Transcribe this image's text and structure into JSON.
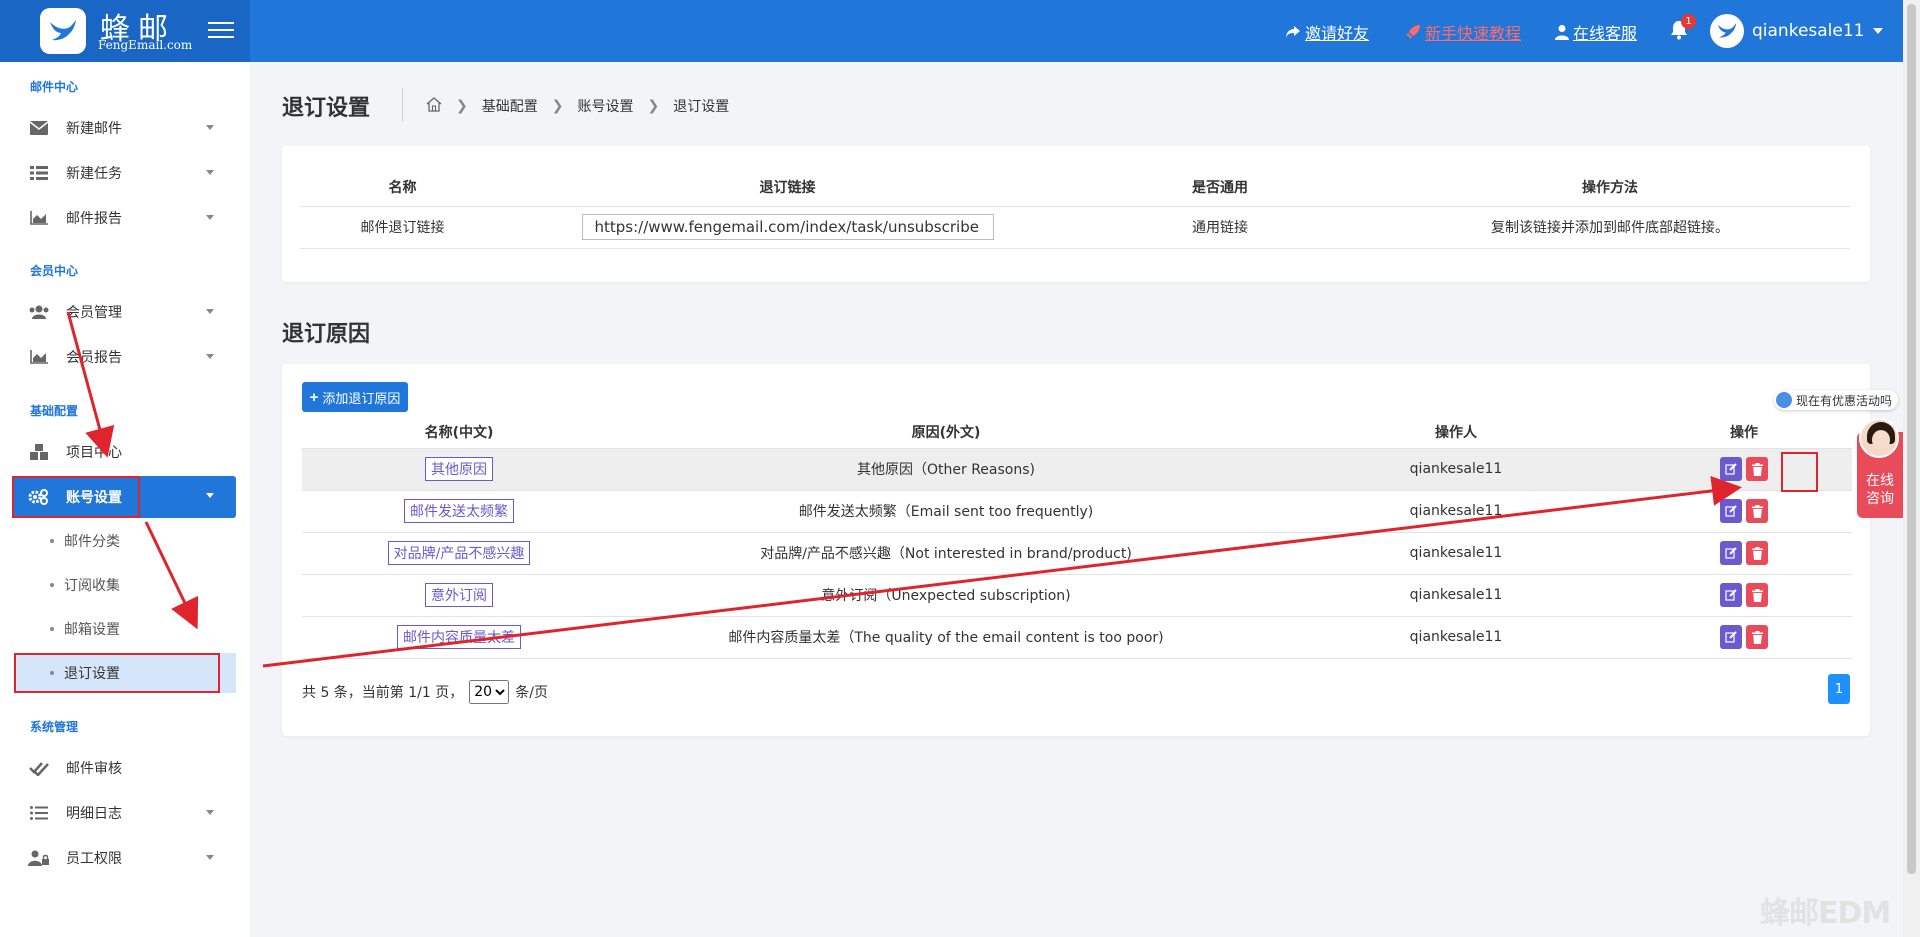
{
  "brand": {
    "name": "蜂邮",
    "domain": "FengEmail.com"
  },
  "topbar": {
    "invite": "邀请好友",
    "tutorial": "新手快速教程",
    "support": "在线客服",
    "notif_count": "1",
    "username": "qiankesale11"
  },
  "sidebar": {
    "sections": [
      "邮件中心",
      "会员中心",
      "基础配置",
      "系统管理"
    ],
    "items": [
      {
        "label": "新建邮件",
        "icon": "envelope-icon"
      },
      {
        "label": "新建任务",
        "icon": "list-icon"
      },
      {
        "label": "邮件报告",
        "icon": "area-chart-icon"
      },
      {
        "label": "会员管理",
        "icon": "users-icon"
      },
      {
        "label": "会员报告",
        "icon": "area-chart-icon"
      },
      {
        "label": "项目中心",
        "icon": "cubes-icon"
      },
      {
        "label": "账号设置",
        "icon": "gears-icon"
      },
      {
        "label": "邮件审核",
        "icon": "double-check-icon"
      },
      {
        "label": "明细日志",
        "icon": "list-ul-icon"
      },
      {
        "label": "员工权限",
        "icon": "user-lock-icon"
      }
    ],
    "subitems": [
      "邮件分类",
      "订阅收集",
      "邮箱设置",
      "退订设置"
    ]
  },
  "page": {
    "title": "退订设置",
    "breadcrumb": [
      "基础配置",
      "账号设置",
      "退订设置"
    ]
  },
  "links_table": {
    "headers": [
      "名称",
      "退订链接",
      "是否通用",
      "操作方法"
    ],
    "row": {
      "name": "邮件退订链接",
      "url": "https://www.fengemail.com/index/task/unsubscribe",
      "common": "通用链接",
      "method": "复制该链接并添加到邮件底部超链接。"
    }
  },
  "reasons": {
    "title": "退订原因",
    "add_button": "添加退订原因",
    "headers": [
      "名称(中文)",
      "原因(外文)",
      "操作人",
      "操作"
    ],
    "rows": [
      {
        "name": "其他原因",
        "reason": "其他原因（Other Reasons)",
        "operator": "qiankesale11"
      },
      {
        "name": "邮件发送太频繁",
        "reason": "邮件发送太频繁（Email sent too frequently)",
        "operator": "qiankesale11"
      },
      {
        "name": "对品牌/产品不感兴趣",
        "reason": "对品牌/产品不感兴趣（Not interested in brand/product)",
        "operator": "qiankesale11"
      },
      {
        "name": "意外订阅",
        "reason": "意外订阅（Unexpected subscription)",
        "operator": "qiankesale11"
      },
      {
        "name": "邮件内容质量太差",
        "reason": "邮件内容质量太差（The quality of the email content is too poor)",
        "operator": "qiankesale11"
      }
    ],
    "pagination": {
      "summary": "共 5 条，当前第 1/1 页，",
      "page_size": "20",
      "per_page_suffix": "条/页",
      "current_page": "1"
    }
  },
  "chat": {
    "bubble": "现在有优惠活动吗",
    "panel_line1": "在线",
    "panel_line2": "咨询"
  },
  "watermark": "蜂邮EDM",
  "colors": {
    "primary": "#2176d9",
    "danger": "#e84c5b",
    "edit": "#6a5acd",
    "annotation": "#e0242d"
  }
}
